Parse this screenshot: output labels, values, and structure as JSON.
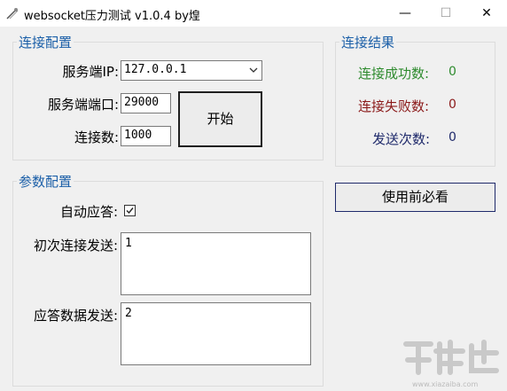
{
  "window": {
    "title": "websocket压力测试 v1.0.4 by煌",
    "min_glyph": "—",
    "max_glyph": "☐",
    "close_glyph": "✕"
  },
  "connection_config": {
    "group_title": "连接配置",
    "server_ip_label": "服务端IP:",
    "server_ip_value": "127.0.0.1",
    "server_port_label": "服务端端口:",
    "server_port_value": "29000",
    "connections_label": "连接数:",
    "connections_value": "1000",
    "start_label": "开始"
  },
  "connection_result": {
    "group_title": "连接结果",
    "success_label": "连接成功数:",
    "success_value": "0",
    "fail_label": "连接失败数:",
    "fail_value": "0",
    "sent_label": "发送次数:",
    "sent_value": "0",
    "colors": {
      "success": "#2e8b2e",
      "fail": "#8b1a1a",
      "sent": "#1f2a6b"
    }
  },
  "manual_button_label": "使用前必看",
  "param_config": {
    "group_title": "参数配置",
    "auto_reply_label": "自动应答:",
    "auto_reply_checked": true,
    "first_send_label": "初次连接发送:",
    "first_send_value": "1",
    "reply_data_label": "应答数据发送:",
    "reply_data_value": "2"
  },
  "watermark": {
    "text": "www.xiazaiba.com"
  },
  "icons": [
    "app-icon",
    "chevron-down-icon",
    "checkmark-icon",
    "minimize-icon",
    "maximize-icon",
    "close-icon"
  ]
}
